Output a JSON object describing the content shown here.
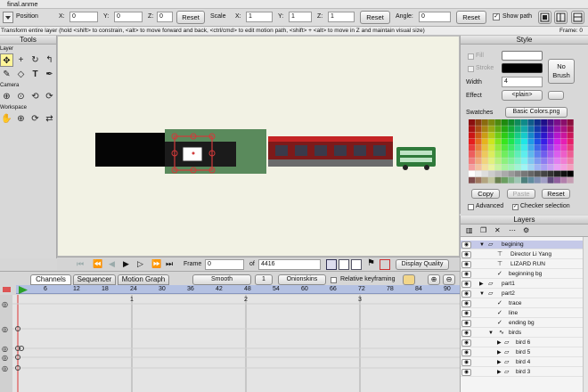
{
  "window": {
    "title": "final.anme"
  },
  "toolbar": {
    "position_label": "Position",
    "x_label": "X:",
    "x_value": "0",
    "y_label": "Y:",
    "y_value": "0",
    "z_label": "Z:",
    "z_value": "0",
    "reset1": "Reset",
    "scale_label": "Scale",
    "sx_label": "X:",
    "sx_value": "1",
    "sy_label": "Y:",
    "sy_value": "1",
    "sz_label": "Z:",
    "sz_value": "1",
    "reset2": "Reset",
    "angle_label": "Angle:",
    "angle_value": "0",
    "reset3": "Reset",
    "show_path": "Show path"
  },
  "status": {
    "message": "Transform entire layer (hold <shift> to constrain, <alt> to move forward and back, <ctrl/cmd> to edit motion path, <shift> + <alt> to move in Z and maintain visual size)",
    "frame": "Frame: 0"
  },
  "tools": {
    "title": "Tools",
    "sections": {
      "layer": "Layer",
      "camera": "Camera",
      "workspace": "Workspace"
    }
  },
  "style": {
    "title": "Style",
    "fill": "Fill",
    "stroke": "Stroke",
    "no_brush": "No Brush",
    "width_label": "Width",
    "width_value": "4",
    "effect_label": "Effect",
    "effect_value": "<plain>",
    "swatches_label": "Swatches",
    "swatches_value": "Basic Colors.png",
    "copy": "Copy",
    "paste": "Paste",
    "reset": "Reset",
    "advanced": "Advanced",
    "checker": "Checker selection",
    "colors": {
      "fill": "#ffffff",
      "stroke": "#000000"
    }
  },
  "layers": {
    "title": "Layers",
    "rows": [
      {
        "name": "begining",
        "indent": 1,
        "type": "folder-open",
        "selected": true
      },
      {
        "name": "Director   Li Yang",
        "indent": 3,
        "type": "text"
      },
      {
        "name": "LIZARD RUN",
        "indent": 3,
        "type": "text"
      },
      {
        "name": "beginning bg",
        "indent": 3,
        "type": "vector"
      },
      {
        "name": "part1",
        "indent": 1,
        "type": "folder"
      },
      {
        "name": "part2",
        "indent": 1,
        "type": "folder-open"
      },
      {
        "name": "trace",
        "indent": 3,
        "type": "vector"
      },
      {
        "name": "line",
        "indent": 3,
        "type": "vector"
      },
      {
        "name": "ending bg",
        "indent": 3,
        "type": "vector"
      },
      {
        "name": "birds",
        "indent": 2,
        "type": "group"
      },
      {
        "name": "bird 6",
        "indent": 3,
        "type": "folder"
      },
      {
        "name": "bird 5",
        "indent": 3,
        "type": "folder"
      },
      {
        "name": "bird 4",
        "indent": 3,
        "type": "folder"
      },
      {
        "name": "bird 3",
        "indent": 3,
        "type": "folder"
      }
    ]
  },
  "timecontrols": {
    "frame_label": "Frame",
    "frame_value": "0",
    "of_label": "of",
    "total_value": "4416",
    "display_quality": "Display Quality"
  },
  "timeline": {
    "tabs": [
      "Channels",
      "Sequencer",
      "Motion Graph"
    ],
    "smooth": "Smooth",
    "interp": "1",
    "onionskins": "Onionskins",
    "relative": "Relative keyframing",
    "ruler": [
      "0",
      "6",
      "12",
      "18",
      "24",
      "30",
      "36",
      "42",
      "48",
      "54",
      "60",
      "66",
      "72",
      "78",
      "84",
      "90"
    ],
    "second_markers": [
      "1",
      "2",
      "3"
    ]
  }
}
